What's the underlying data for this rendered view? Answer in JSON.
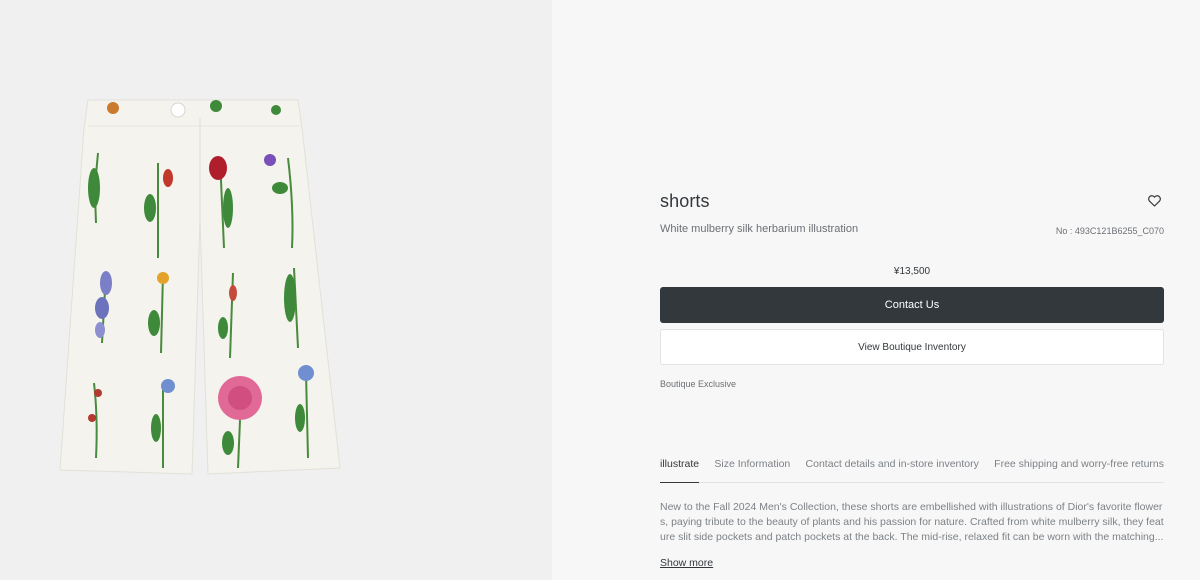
{
  "product": {
    "name": "shorts",
    "subtitle": "White mulberry silk herbarium illustration",
    "reference": "No : 493C121B6255_C070",
    "price": "¥13,500",
    "badge": "Boutique Exclusive"
  },
  "actions": {
    "contact": "Contact Us",
    "inventory": "View Boutique Inventory"
  },
  "tabs": [
    {
      "label": "illustrate"
    },
    {
      "label": "Size Information"
    },
    {
      "label": "Contact details and in-store inventory"
    },
    {
      "label": "Free shipping and worry-free returns"
    }
  ],
  "description": {
    "text": "New to the Fall 2024 Men's Collection, these shorts are embellished with illustrations of Dior's favorite flowers, paying tribute to the beauty of plants and his passion for nature. Crafted from white mulberry silk, they feature slit side pockets and patch pockets at the back. The mid-rise, relaxed fit can be worn with the matching...",
    "more": "Show more"
  },
  "colors": {
    "accent": "#33383c",
    "muted": "#7d8287",
    "panel": "#f0f0f0"
  },
  "icons": {
    "wishlist": "heart-icon"
  }
}
